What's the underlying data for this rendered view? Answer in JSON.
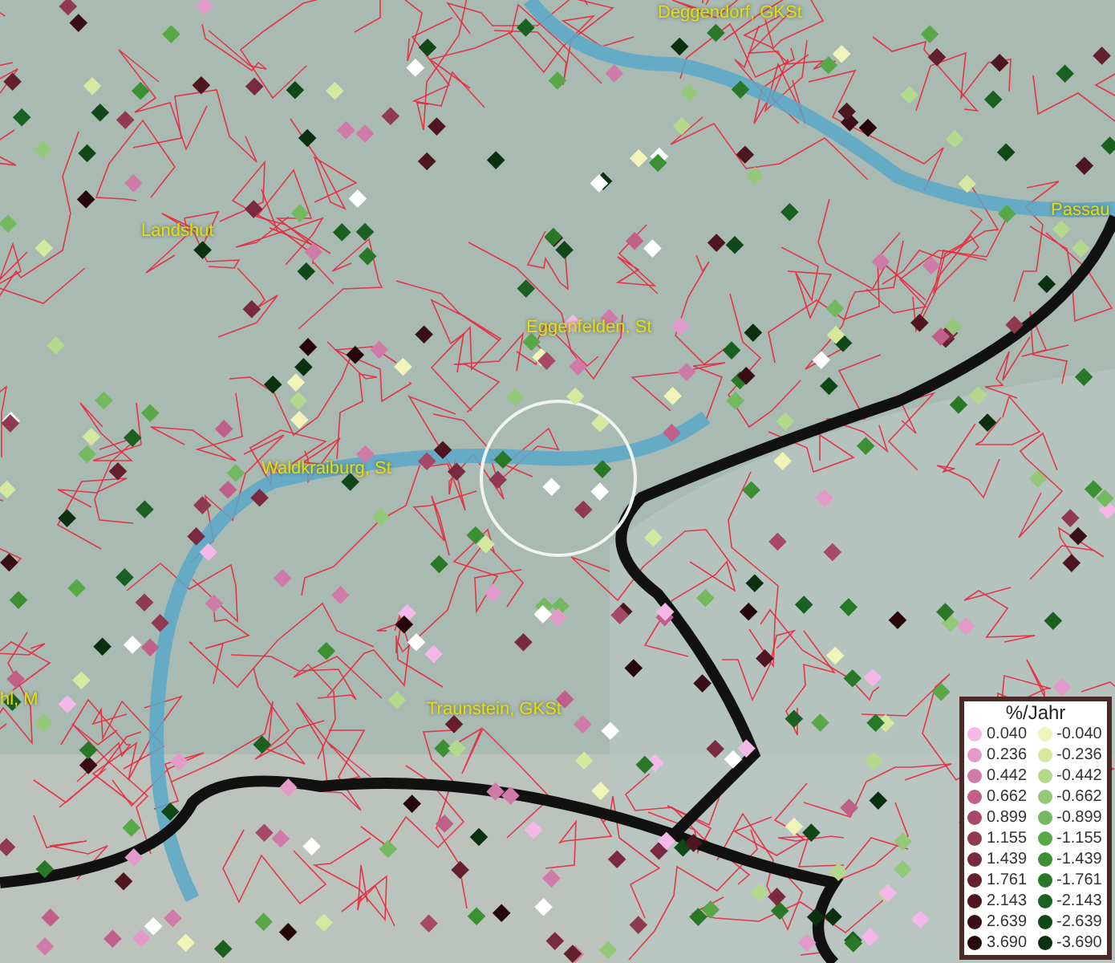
{
  "map": {
    "place_labels": [
      "Deggendorf, GKSt",
      "Passau",
      "Landshut",
      "Eggenfelden, St",
      "Waldkraiburg, St",
      "hl, M",
      "Traunstein, GKSt"
    ]
  },
  "legend": {
    "title": "%/Jahr",
    "columns": [
      [
        {
          "label": "0.040",
          "color": "#f4b8e8"
        },
        {
          "label": "0.236",
          "color": "#e49ac8"
        },
        {
          "label": "0.442",
          "color": "#d07aa8"
        },
        {
          "label": "0.662",
          "color": "#c06088"
        },
        {
          "label": "0.899",
          "color": "#a84868"
        },
        {
          "label": "1.155",
          "color": "#903a52"
        },
        {
          "label": "1.439",
          "color": "#7a2a40"
        },
        {
          "label": "1.761",
          "color": "#64202e"
        },
        {
          "label": "2.143",
          "color": "#4e1620"
        },
        {
          "label": "2.639",
          "color": "#3a0e16"
        },
        {
          "label": "3.690",
          "color": "#26080c"
        }
      ],
      [
        {
          "label": "-0.040",
          "color": "#f0f4b8"
        },
        {
          "label": "-0.236",
          "color": "#d4e8a0"
        },
        {
          "label": "-0.442",
          "color": "#b4d88c"
        },
        {
          "label": "-0.662",
          "color": "#94c878"
        },
        {
          "label": "-0.899",
          "color": "#74b860"
        },
        {
          "label": "-1.155",
          "color": "#58a848"
        },
        {
          "label": "-1.439",
          "color": "#3c9034"
        },
        {
          "label": "-1.761",
          "color": "#287828"
        },
        {
          "label": "-2.143",
          "color": "#1a6020"
        },
        {
          "label": "-2.639",
          "color": "#104818"
        },
        {
          "label": "-3.690",
          "color": "#0a3010"
        }
      ]
    ]
  }
}
